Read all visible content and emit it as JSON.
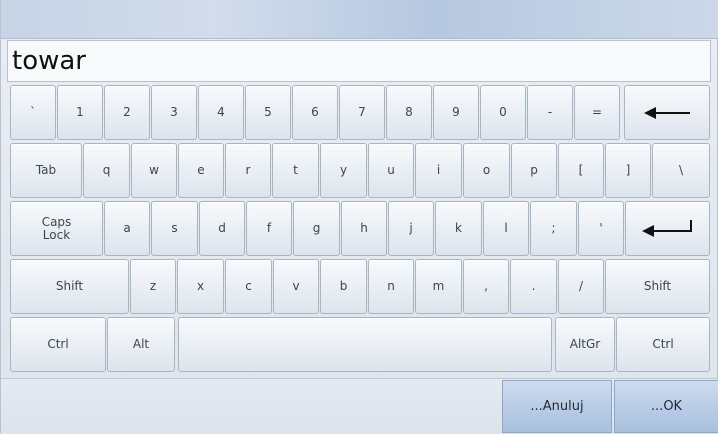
{
  "input": {
    "value": "towar"
  },
  "keyboard": {
    "row1": [
      "`",
      "1",
      "2",
      "3",
      "4",
      "5",
      "6",
      "7",
      "8",
      "9",
      "0",
      "-",
      "="
    ],
    "row2": [
      "Tab",
      "q",
      "w",
      "e",
      "r",
      "t",
      "y",
      "u",
      "i",
      "o",
      "p",
      "[",
      "]",
      "\\"
    ],
    "row3": [
      "Caps\nLock",
      "a",
      "s",
      "d",
      "f",
      "g",
      "h",
      "j",
      "k",
      "l",
      ";",
      "'"
    ],
    "row4": [
      "Shift",
      "z",
      "x",
      "c",
      "v",
      "b",
      "n",
      "m",
      ",",
      ".",
      "/",
      "Shift"
    ],
    "row5": [
      "Ctrl",
      "Alt",
      "",
      "AltGr",
      "Ctrl"
    ],
    "icons": {
      "backspace": "backspace-arrow-icon",
      "enter": "enter-arrow-icon"
    }
  },
  "actions": {
    "cancel_label": "...Anuluj",
    "ok_label": "...OK"
  }
}
